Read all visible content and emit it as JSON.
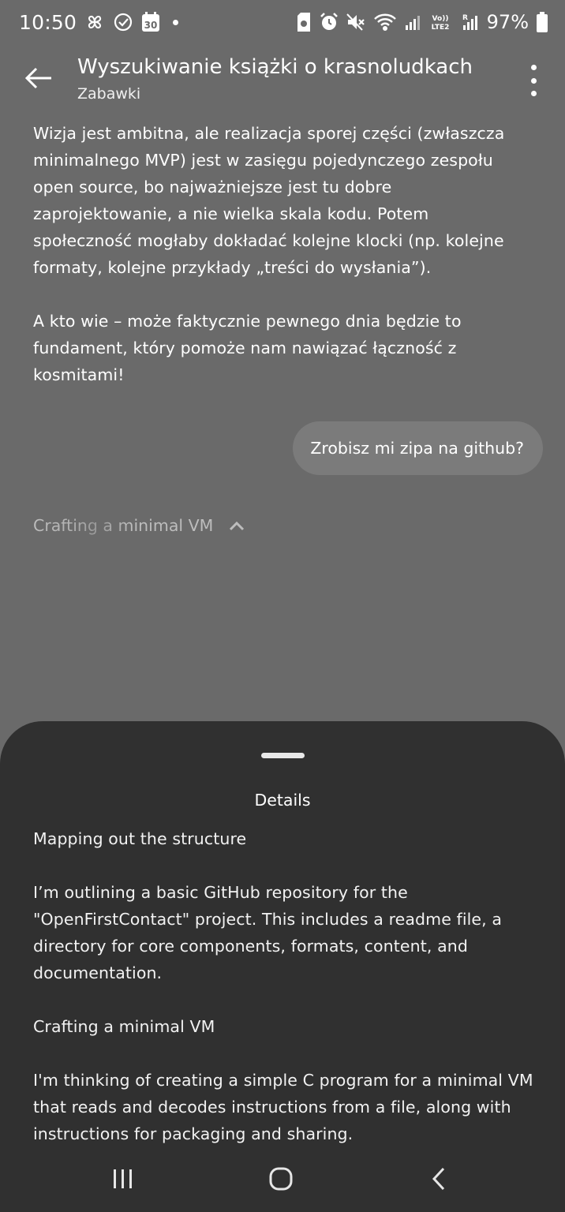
{
  "status_bar": {
    "time": "10:50",
    "battery": "97%",
    "icons_left": [
      "pinwheel-icon",
      "check-circle-icon",
      "calendar-icon",
      "dot-icon"
    ],
    "calendar_day": "30",
    "icons_right": [
      "sim-icon",
      "alarm-icon",
      "mute-icon",
      "wifi-icon",
      "signal-icon",
      "volte-icon",
      "signal-roaming-icon",
      "battery-icon"
    ]
  },
  "header": {
    "title": "Wyszukiwanie książki o krasnoludkach",
    "subtitle": "Zabawki"
  },
  "conversation": {
    "assistant_paragraphs": [
      "Wizja jest ambitna, ale realizacja sporej części (zwłaszcza minimalnego MVP) jest w zasięgu pojedynczego zespołu open source, bo najważniejsze jest tu dobre zaprojektowanie, a nie wielka skala kodu. Potem społeczność mogłaby dokładać kolejne klocki (np. kolejne formaty, kolejne przykłady „treści do wysłania”).",
      "A kto wie – może faktycznie pewnego dnia będzie to fundament, który pomoże nam nawiązać łączność z kosmitami!"
    ],
    "user_message": "Zrobisz mi zipa na github?",
    "thinking_status": "Crafting a minimal VM"
  },
  "details_sheet": {
    "title": "Details",
    "paragraphs": [
      "Mapping out the structure",
      "I’m outlining a basic GitHub repository for the \"OpenFirstContact\" project. This includes a readme file, a directory for core components, formats, content, and documentation.",
      "Crafting a minimal VM",
      "I'm thinking of creating a simple C program for a minimal VM that reads and decodes instructions from a file, along with instructions for packaging and sharing."
    ]
  },
  "colors": {
    "background": "#6a6a6a",
    "user_bubble": "#7b7b7b",
    "sheet": "#303030",
    "text": "#ffffff"
  }
}
